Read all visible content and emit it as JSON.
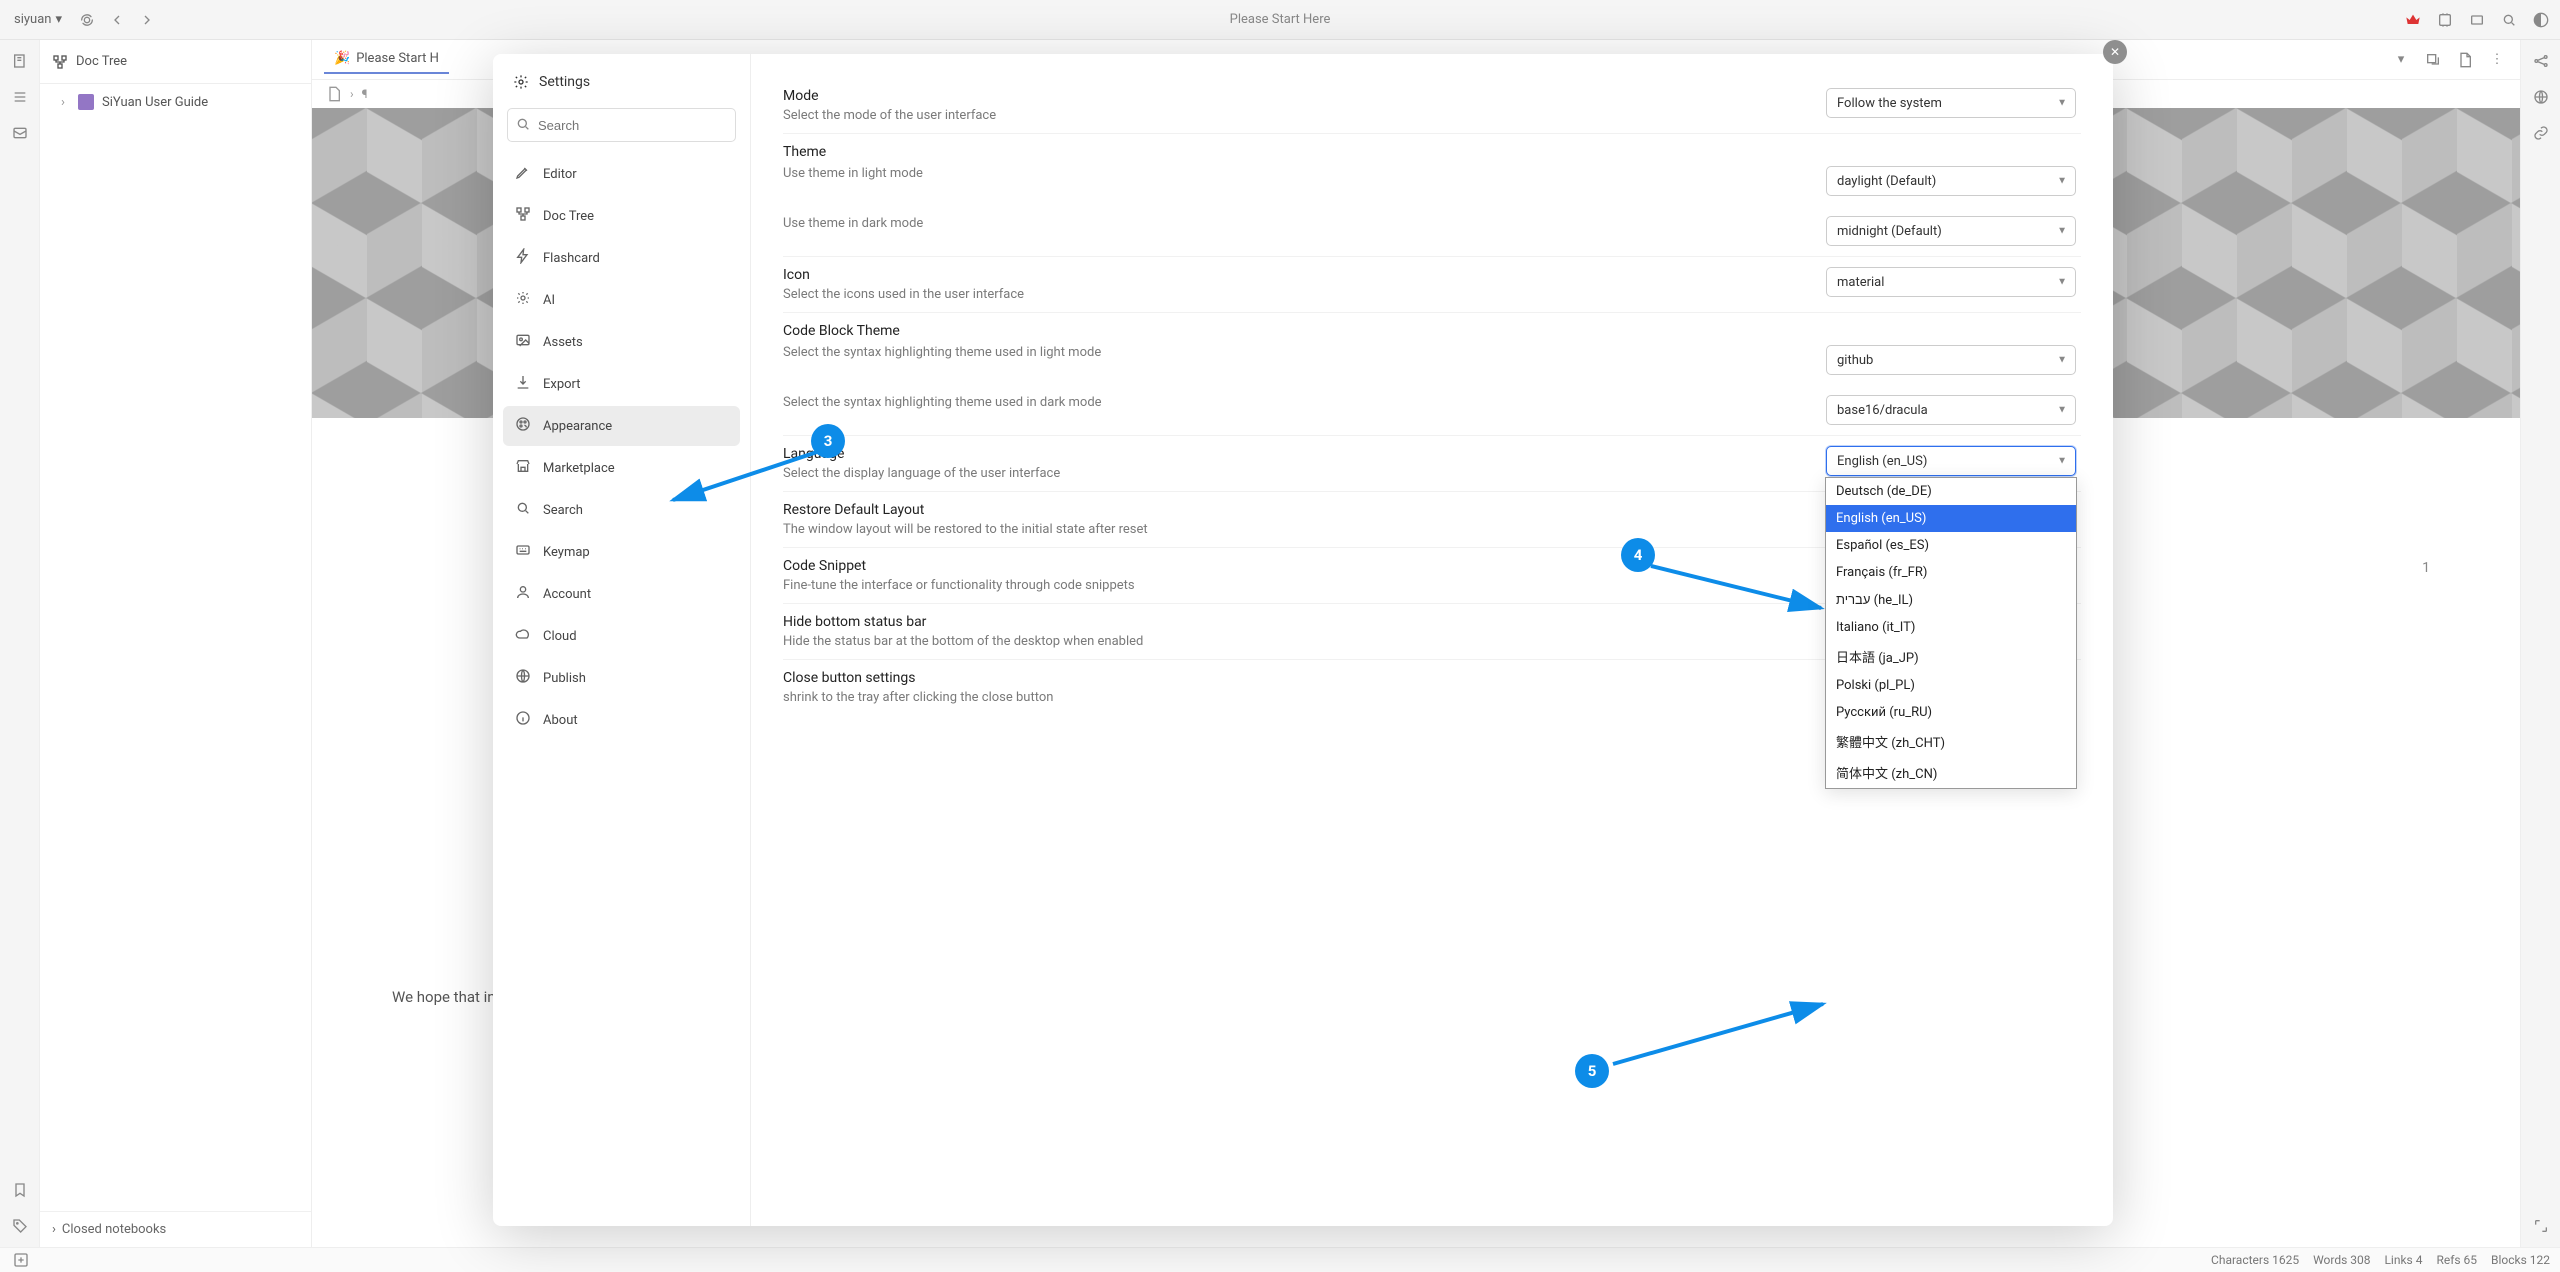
{
  "topbar": {
    "app_name": "siyuan",
    "title": "Please Start Here"
  },
  "tab": {
    "label": "Please Start H"
  },
  "doctree": {
    "title": "Doc Tree",
    "items": [
      {
        "label": "SiYuan User Guide"
      }
    ],
    "footer": "Closed notebooks"
  },
  "settings": {
    "title": "Settings",
    "search_placeholder": "Search",
    "side": [
      {
        "key": "editor",
        "label": "Editor"
      },
      {
        "key": "doctree",
        "label": "Doc Tree"
      },
      {
        "key": "flashcard",
        "label": "Flashcard"
      },
      {
        "key": "ai",
        "label": "AI"
      },
      {
        "key": "assets",
        "label": "Assets"
      },
      {
        "key": "export",
        "label": "Export"
      },
      {
        "key": "appearance",
        "label": "Appearance"
      },
      {
        "key": "marketplace",
        "label": "Marketplace"
      },
      {
        "key": "search",
        "label": "Search"
      },
      {
        "key": "keymap",
        "label": "Keymap"
      },
      {
        "key": "account",
        "label": "Account"
      },
      {
        "key": "cloud",
        "label": "Cloud"
      },
      {
        "key": "publish",
        "label": "Publish"
      },
      {
        "key": "about",
        "label": "About"
      }
    ],
    "sections": {
      "mode": {
        "title": "Mode",
        "desc": "Select the mode of the user interface",
        "value": "Follow the system"
      },
      "theme": {
        "title": "Theme",
        "light_desc": "Use theme in light mode",
        "light_value": "daylight (Default)",
        "dark_desc": "Use theme in dark mode",
        "dark_value": "midnight (Default)"
      },
      "icon": {
        "title": "Icon",
        "desc": "Select the icons used in the user interface",
        "value": "material"
      },
      "code": {
        "title": "Code Block Theme",
        "light_desc": "Select the syntax highlighting theme used in light mode",
        "light_value": "github",
        "dark_desc": "Select the syntax highlighting theme used in dark mode",
        "dark_value": "base16/dracula"
      },
      "language": {
        "title": "Language",
        "desc": "Select the display language of the user interface",
        "value": "English (en_US)",
        "options": [
          "Deutsch (de_DE)",
          "English (en_US)",
          "Español (es_ES)",
          "Français (fr_FR)",
          "עברית (he_IL)",
          "Italiano (it_IT)",
          "日本語 (ja_JP)",
          "Polski (pl_PL)",
          "Русский (ru_RU)",
          "繁體中文 (zh_CHT)",
          "简体中文 (zh_CN)"
        ],
        "selected_index": 1
      },
      "restore": {
        "title": "Restore Default Layout",
        "desc": "The window layout will be restored to the initial state after reset"
      },
      "snippet": {
        "title": "Code Snippet",
        "desc": "Fine-tune the interface or functionality through code snippets"
      },
      "status": {
        "title": "Hide bottom status bar",
        "desc": "Hide the status bar at the bottom of the desktop when enabled"
      },
      "close": {
        "title": "Close button settings",
        "desc": "shrink to the tray after clicking the close button"
      }
    }
  },
  "annotations": {
    "three": "3",
    "four": "4",
    "five": "5"
  },
  "doc": {
    "truncated": "We hope that in the coming time, SiYuan can become an efficient tool for your life and study, helping you achieve more goals and plans🙏",
    "page": "1"
  },
  "status": {
    "chars": "Characters 1625",
    "words": "Words 308",
    "links": "Links 4",
    "refs": "Refs 65",
    "blocks": "Blocks 122"
  }
}
